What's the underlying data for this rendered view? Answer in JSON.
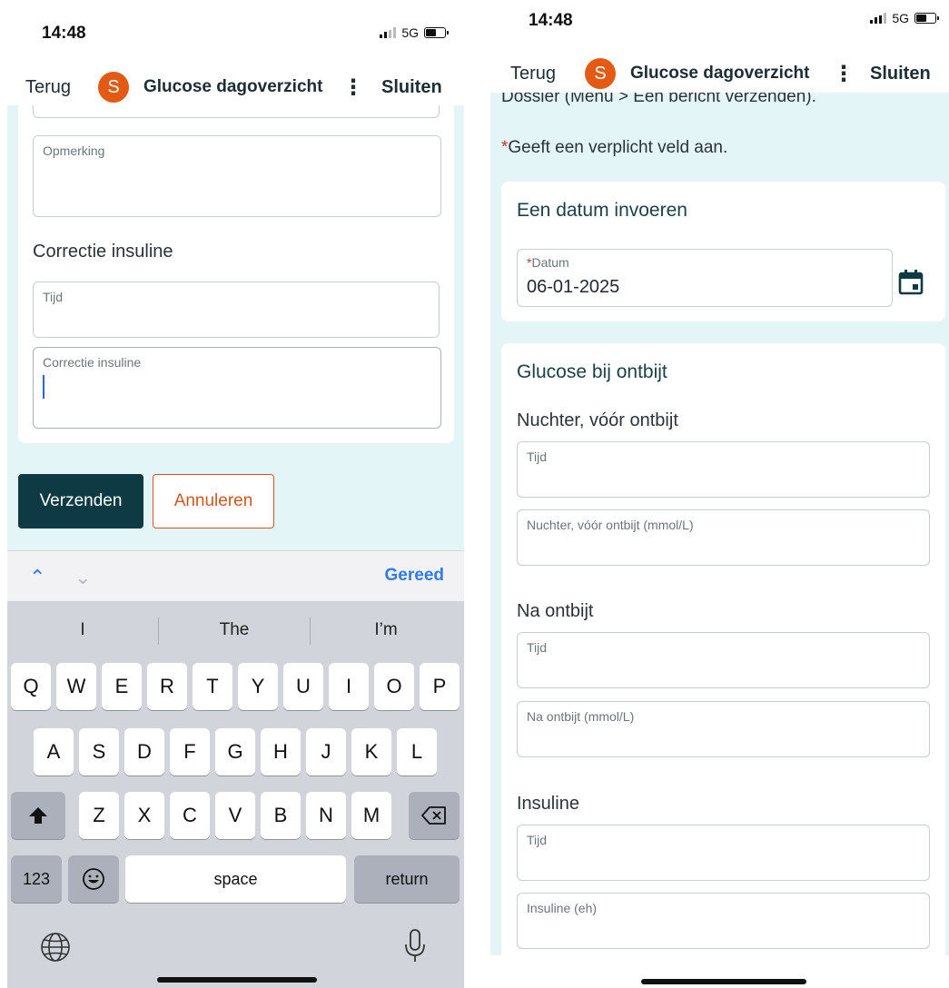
{
  "status_left": {
    "time": "14:48",
    "network": "5G"
  },
  "status_right": {
    "time": "14:48",
    "network": "5G"
  },
  "nav": {
    "back": "Terug",
    "avatar_letter": "S",
    "title": "Glucose dagoverzicht",
    "more": "⋮",
    "close": "Sluiten"
  },
  "left": {
    "remark_label": "Opmerking",
    "correction_title": "Correctie insuline",
    "time_label": "Tijd",
    "correction_label": "Correctie insuline",
    "send_label": "Verzenden",
    "cancel_label": "Annuleren",
    "accessory": {
      "up": "⌃",
      "down": "⌄",
      "done": "Gereed"
    },
    "suggestions": [
      "I",
      "The",
      "I’m"
    ]
  },
  "keyboard": {
    "row1": [
      "Q",
      "W",
      "E",
      "R",
      "T",
      "Y",
      "U",
      "I",
      "O",
      "P"
    ],
    "row2": [
      "A",
      "S",
      "D",
      "F",
      "G",
      "H",
      "J",
      "K",
      "L"
    ],
    "row3": [
      "Z",
      "X",
      "C",
      "V",
      "B",
      "N",
      "M"
    ],
    "numbers": "123",
    "space": "space",
    "return": "return"
  },
  "right": {
    "intro_cut": "Dossier (Menu > Een bericht verzenden).",
    "required_star": "*",
    "required_note": "Geeft een verplicht veld aan.",
    "date_section_title": "Een datum invoeren",
    "date_label": "Datum",
    "date_value": "06-01-2025",
    "glucose_section_title": "Glucose bij ontbijt",
    "fasting_title": "Nuchter, vóór ontbijt",
    "time_label": "Tijd",
    "fasting_label": "Nuchter, vóór ontbijt (mmol/L)",
    "after_title": "Na ontbijt",
    "after_label": "Na ontbijt (mmol/L)",
    "insulin_title": "Insuline",
    "insulin_label": "Insuline (eh)"
  }
}
